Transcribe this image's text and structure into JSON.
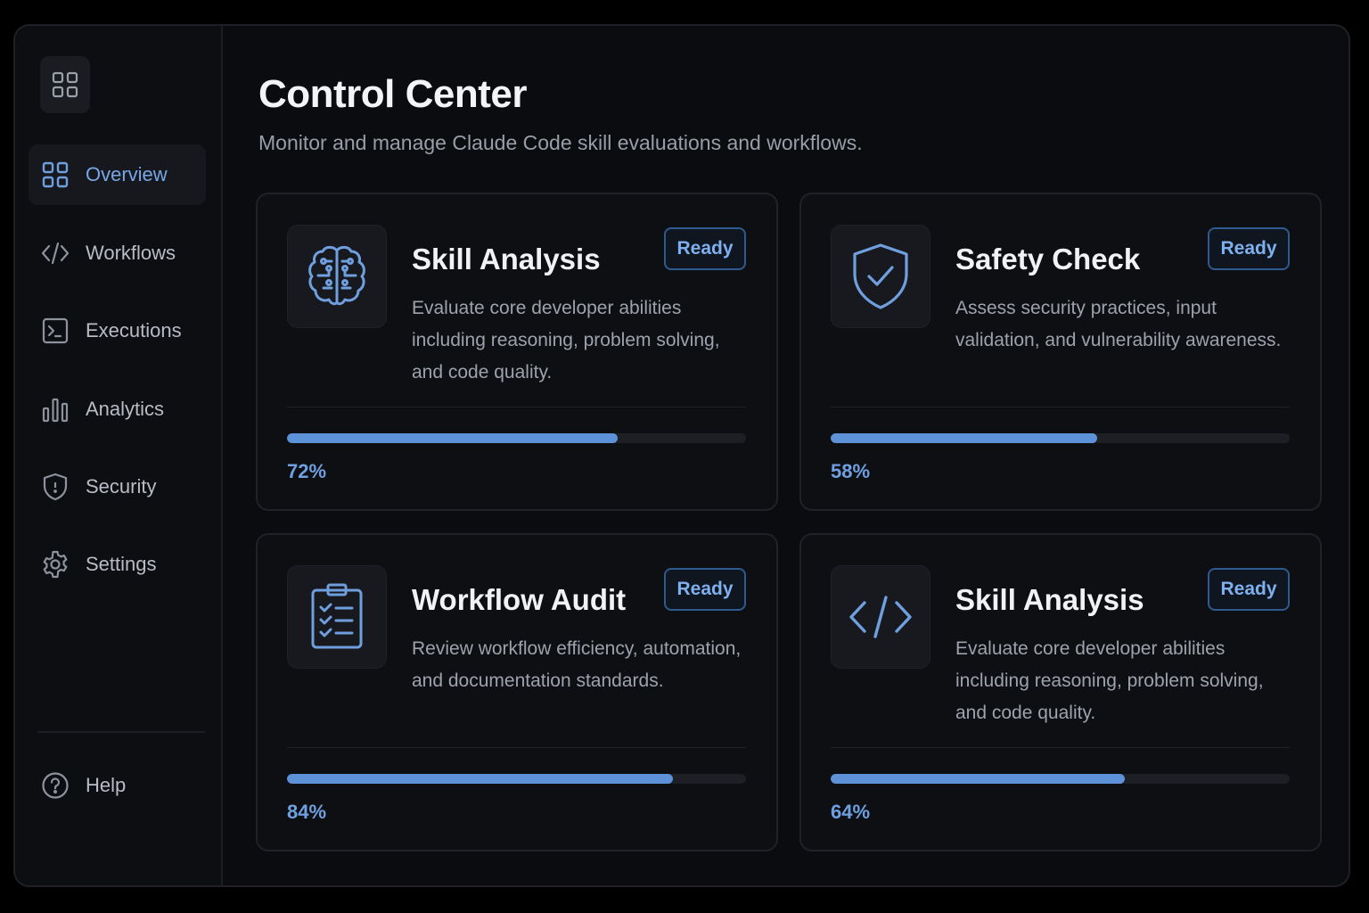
{
  "sidebar": {
    "logo_icon": "grid-icon",
    "items": [
      {
        "label": "Overview",
        "icon": "grid-icon",
        "active": true
      },
      {
        "label": "Workflows",
        "icon": "code-icon",
        "active": false
      },
      {
        "label": "Executions",
        "icon": "terminal-icon",
        "active": false
      },
      {
        "label": "Analytics",
        "icon": "bar-chart-icon",
        "active": false
      },
      {
        "label": "Security",
        "icon": "shield-icon",
        "active": false
      },
      {
        "label": "Settings",
        "icon": "gear-icon",
        "active": false
      }
    ],
    "help": {
      "label": "Help",
      "icon": "help-circle-icon"
    }
  },
  "header": {
    "title": "Control Center",
    "subtitle": "Monitor and manage Claude Code skill evaluations and workflows."
  },
  "cards": [
    {
      "title": "Skill Analysis",
      "status": "Ready",
      "description": "Evaluate core developer abilities including reasoning, problem solving, and code quality.",
      "progress": 72,
      "progress_label": "72%",
      "icon": "brain-icon"
    },
    {
      "title": "Safety Check",
      "status": "Ready",
      "description": "Assess security practices, input validation, and vulnerability awareness.",
      "progress": 58,
      "progress_label": "58%",
      "icon": "shield-check-icon"
    },
    {
      "title": "Workflow Audit",
      "status": "Ready",
      "description": "Review workflow efficiency, automation, and documentation standards.",
      "progress": 84,
      "progress_label": "84%",
      "icon": "clipboard-checklist-icon"
    },
    {
      "title": "Skill Analysis",
      "status": "Ready",
      "description": "Evaluate core developer abilities including reasoning, problem solving, and code quality.",
      "progress": 64,
      "progress_label": "64%",
      "icon": "code-icon"
    }
  ],
  "colors": {
    "accent": "#5e92d8",
    "accent_text": "#77a7e6",
    "background": "#0b0c10",
    "card_background": "#0e0f13"
  }
}
